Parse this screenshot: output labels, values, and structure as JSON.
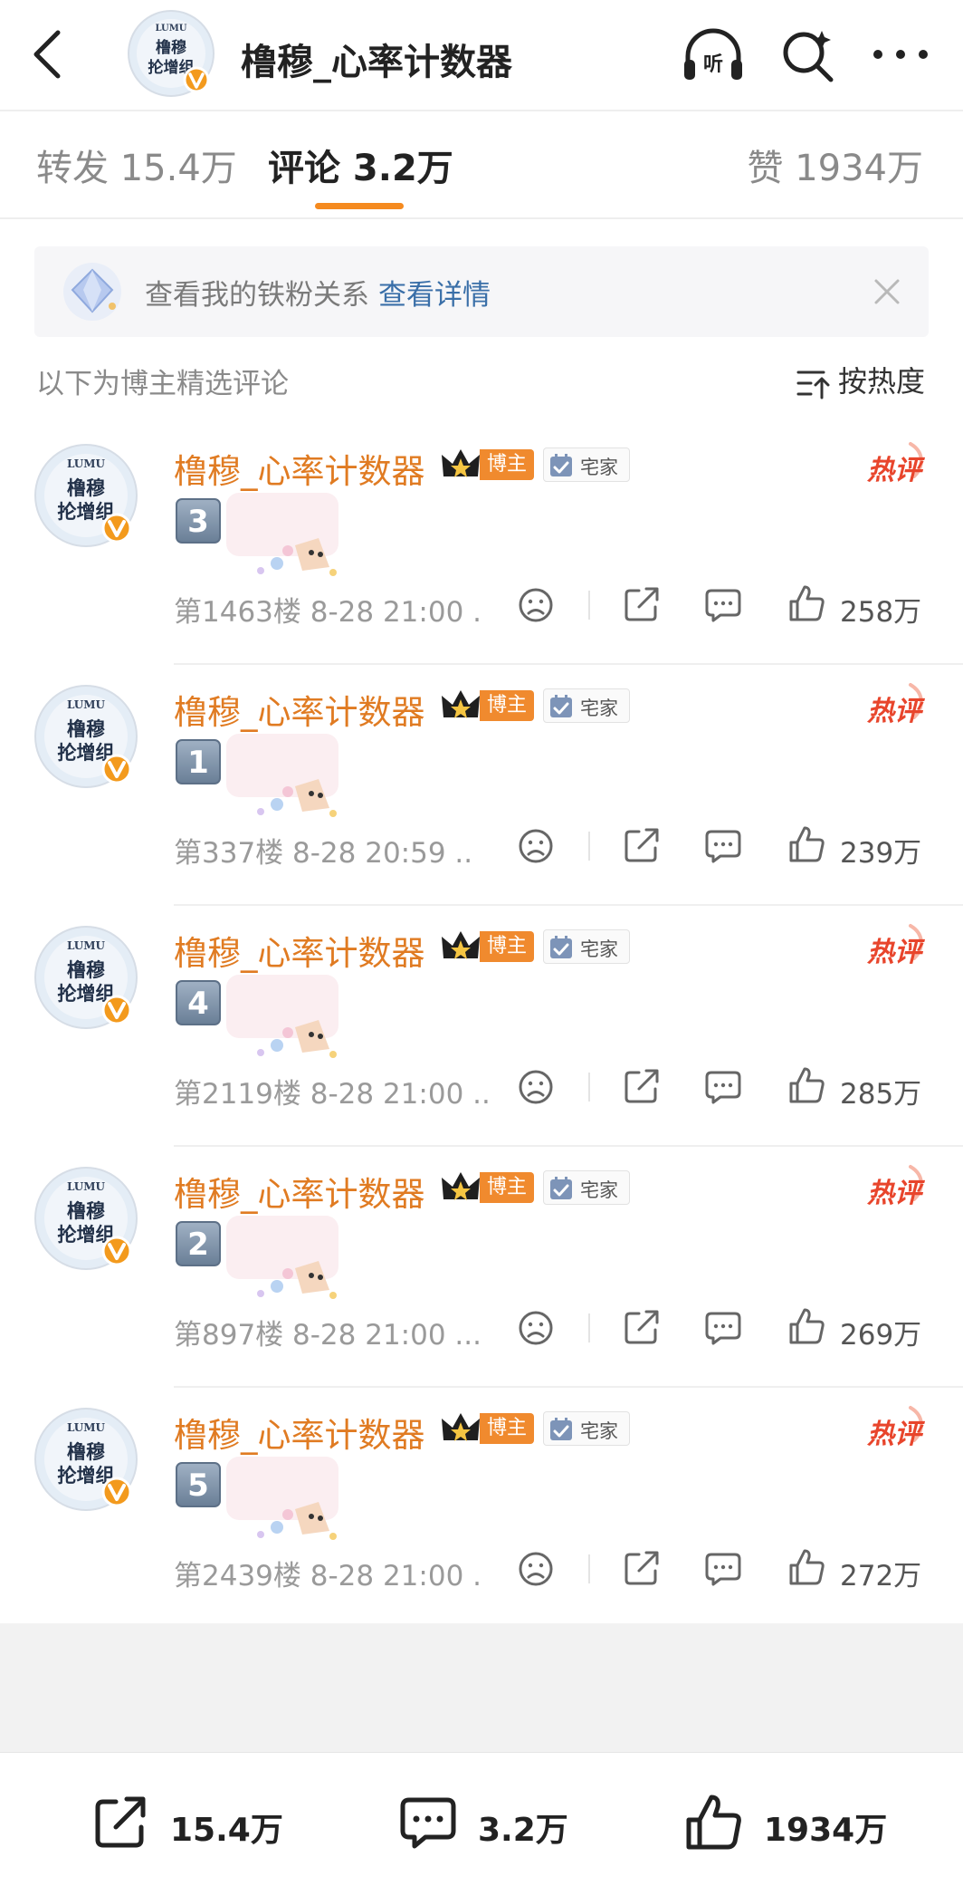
{
  "header": {
    "title": "橹穆_心率计数器",
    "avatar_text": [
      "LUMU",
      "橹穆",
      "抡增组"
    ],
    "listen_label": "听"
  },
  "tabs": {
    "repost": "转发 15.4万",
    "comment": "评论 3.2万",
    "like": "赞 1934万"
  },
  "fan_banner": {
    "text": "查看我的铁粉关系",
    "link": "查看详情"
  },
  "section": {
    "label": "以下为博主精选评论",
    "sort_label": "按热度"
  },
  "comment_common": {
    "username": "橹穆_心率计数器",
    "role_badge": "博主",
    "fan_badge": "宅家",
    "hot_badge": "热评"
  },
  "comments": [
    {
      "number": "3",
      "floor": "第1463楼 8-28 21:00 .",
      "likes": "258万"
    },
    {
      "number": "1",
      "floor": "第337楼 8-28 20:59 ..",
      "likes": "239万"
    },
    {
      "number": "4",
      "floor": "第2119楼 8-28 21:00 ..",
      "likes": "285万"
    },
    {
      "number": "2",
      "floor": "第897楼 8-28 21:00 ...",
      "likes": "269万"
    },
    {
      "number": "5",
      "floor": "第2439楼 8-28 21:00 .",
      "likes": "272万"
    }
  ],
  "bottom_bar": {
    "repost": "15.4万",
    "comment": "3.2万",
    "like": "1934万"
  },
  "colors": {
    "accent": "#f58a1f",
    "username": "#e07b22",
    "hot": "#e8452c",
    "link": "#3a6fa8"
  }
}
